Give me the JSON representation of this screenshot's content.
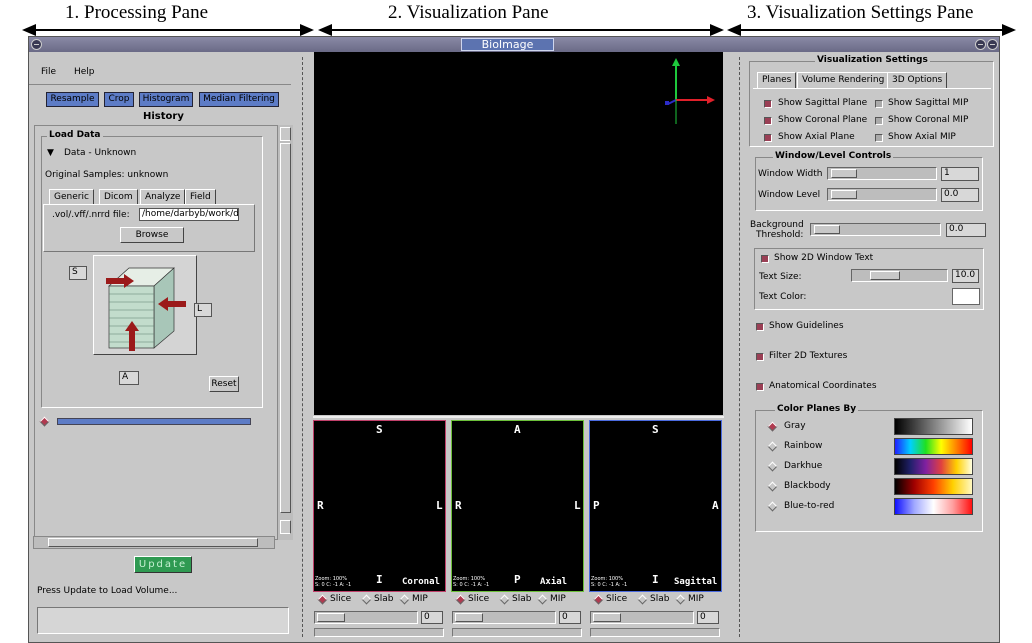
{
  "annotations": {
    "processing": "1. Processing Pane",
    "visualization": "2. Visualization Pane",
    "settings": "3. Visualization Settings Pane"
  },
  "window": {
    "title": "BioImage"
  },
  "menu": {
    "file": "File",
    "help": "Help"
  },
  "processing": {
    "buttons": [
      "Resample",
      "Crop",
      "Histogram",
      "Median Filtering"
    ],
    "history_title": "History",
    "load_data": {
      "title": "Load Data",
      "data_label": "Data - Unknown",
      "original_samples": "Original Samples: unknown",
      "tabs": [
        "Generic",
        "Dicom",
        "Analyze",
        "Field"
      ],
      "file_label": ".vol/.vff/.nrrd file:",
      "file_value": "/home/darbyb/work/da",
      "browse": "Browse",
      "s_label": "S",
      "l_label": "L",
      "a_label": "A",
      "reset": "Reset"
    },
    "update": "Update",
    "status": "Press Update to Load Volume..."
  },
  "views": [
    {
      "top": "S",
      "left": "R",
      "right": "L",
      "bottom": "I",
      "name": "Coronal",
      "zoom": "Zoom: 100%",
      "coords": "S: 0 C: -1 A: -1",
      "slider_value": "0",
      "border": "#c0406a"
    },
    {
      "top": "A",
      "left": "R",
      "right": "L",
      "bottom": "P",
      "name": "Axial",
      "zoom": "Zoom: 100%",
      "coords": "S: 0 C: -1 A: -1",
      "slider_value": "0",
      "border": "#6cbf3a"
    },
    {
      "top": "S",
      "left": "P",
      "right": "A",
      "bottom": "I",
      "name": "Sagittal",
      "zoom": "Zoom: 100%",
      "coords": "S: 0 C: -1 A: -1",
      "slider_value": "0",
      "border": "#4a6adf"
    }
  ],
  "view_modes": [
    "Slice",
    "Slab",
    "MIP"
  ],
  "settings": {
    "title": "Visualization Settings",
    "tabs": [
      "Planes",
      "Volume Rendering",
      "3D Options"
    ],
    "planes": [
      {
        "label": "Show Sagittal Plane",
        "checked": true
      },
      {
        "label": "Show Sagittal MIP",
        "checked": false
      },
      {
        "label": "Show Coronal Plane",
        "checked": true
      },
      {
        "label": "Show Coronal MIP",
        "checked": false
      },
      {
        "label": "Show Axial Plane",
        "checked": true
      },
      {
        "label": "Show Axial MIP",
        "checked": false
      }
    ],
    "window_level": {
      "title": "Window/Level Controls",
      "width_label": "Window Width",
      "width_value": "1",
      "level_label": "Window Level",
      "level_value": "0.0"
    },
    "background": {
      "label1": "Background",
      "label2": "Threshold:",
      "value": "0.0"
    },
    "text2d": {
      "show_label": "Show 2D Window Text",
      "size_label": "Text Size:",
      "size_value": "10.0",
      "color_label": "Text Color:"
    },
    "options": [
      "Show Guidelines",
      "Filter 2D Textures",
      "Anatomical Coordinates"
    ],
    "color_planes": {
      "title": "Color Planes By",
      "items": [
        "Gray",
        "Rainbow",
        "Darkhue",
        "Blackbody",
        "Blue-to-red"
      ],
      "selected": "Gray"
    }
  },
  "colors": {
    "accent_blue": "#5d7cc6",
    "update_green": "#2f9a52",
    "checked": "#9a3f55"
  }
}
